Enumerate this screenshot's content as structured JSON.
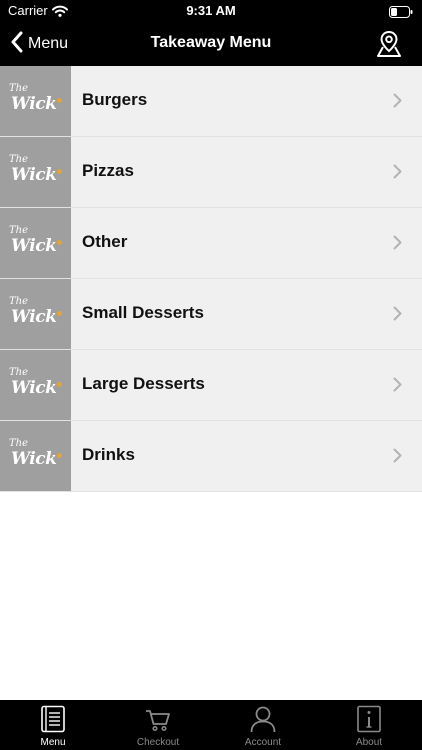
{
  "status_bar": {
    "carrier": "Carrier",
    "time": "9:31 AM"
  },
  "nav": {
    "back_label": "Menu",
    "title": "Takeaway Menu"
  },
  "logo": {
    "top_word": "The",
    "main_word": "Wick"
  },
  "menu": {
    "items": [
      {
        "label": "Burgers"
      },
      {
        "label": "Pizzas"
      },
      {
        "label": "Other"
      },
      {
        "label": "Small Desserts"
      },
      {
        "label": "Large Desserts"
      },
      {
        "label": "Drinks"
      }
    ]
  },
  "tabs": [
    {
      "label": "Menu",
      "icon": "menu-book-icon",
      "active": true
    },
    {
      "label": "Checkout",
      "icon": "cart-icon",
      "active": false
    },
    {
      "label": "Account",
      "icon": "person-icon",
      "active": false
    },
    {
      "label": "About",
      "icon": "info-icon",
      "active": false
    }
  ],
  "colors": {
    "bar_background": "#000000",
    "row_background": "#f0f0f0",
    "thumb_background": "#9f9f9f",
    "logo_accent": "#e2a53a"
  }
}
